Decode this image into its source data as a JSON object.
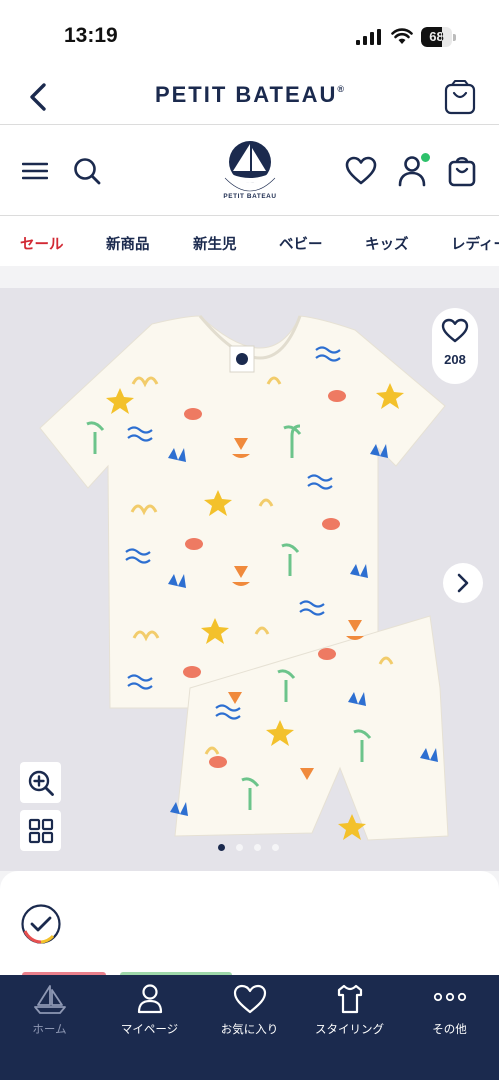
{
  "status_bar": {
    "time": "13:19",
    "battery": "68",
    "battery_level": 0.68
  },
  "top_bar": {
    "brand": "PETIT BATEAU",
    "brand_mark": "®"
  },
  "header": {
    "logo_text": "PETIT BATEAU",
    "icons": [
      "menu-icon",
      "search-icon",
      "heart-icon",
      "account-icon",
      "bag-icon"
    ],
    "notification_color": "#2ec16b"
  },
  "categories": [
    {
      "label": "セール",
      "sale": true
    },
    {
      "label": "新商品"
    },
    {
      "label": "新生児"
    },
    {
      "label": "ベビー"
    },
    {
      "label": "キッズ"
    },
    {
      "label": "レディース"
    }
  ],
  "gallery": {
    "favorites_count": "208",
    "slide_count": 4,
    "active_slide": 1
  },
  "tab_bar": {
    "items": [
      {
        "label": "ホーム",
        "icon": "boat-icon",
        "active": true
      },
      {
        "label": "マイページ",
        "icon": "user-icon"
      },
      {
        "label": "お気に入り",
        "icon": "heart-icon"
      },
      {
        "label": "スタイリング",
        "icon": "tshirt-icon"
      },
      {
        "label": "その他",
        "icon": "more-icon"
      }
    ]
  },
  "colors": {
    "brand_navy": "#1b2a4e",
    "sale_red": "#d22833",
    "gallery_bg": "#e4e3e9"
  }
}
